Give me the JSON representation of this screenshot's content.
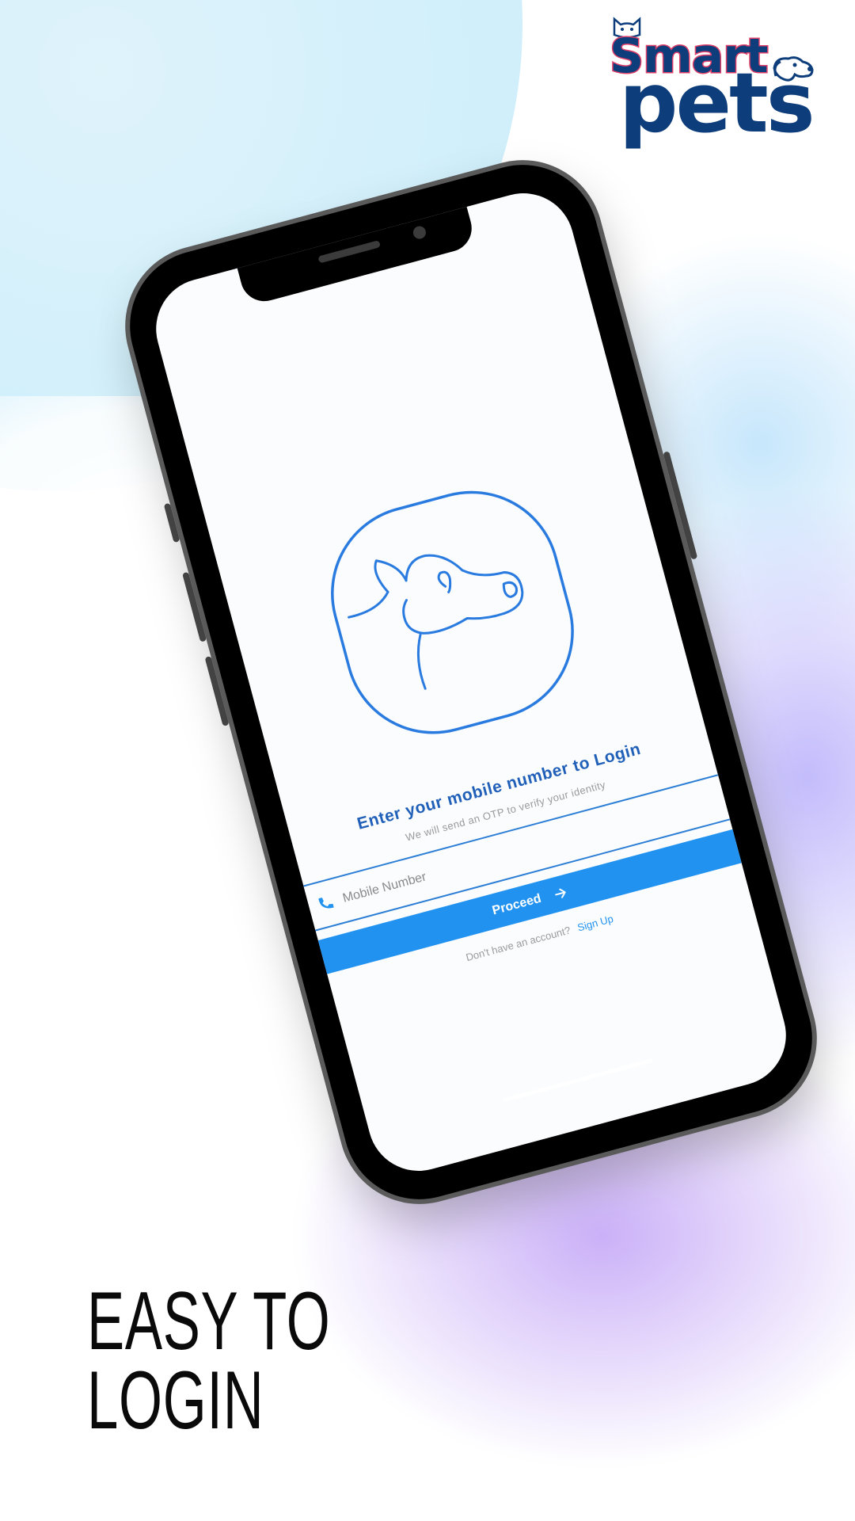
{
  "brand": {
    "name_top": "Smart",
    "name_bottom": "pets",
    "primary_color": "#0d3d7a",
    "accent_color": "#e0406a"
  },
  "login_screen": {
    "title": "Enter your mobile number to Login",
    "subtitle": "We will send an OTP to verify your identity",
    "mobile_field": {
      "placeholder": "Mobile Number",
      "value": "",
      "icon": "phone-icon"
    },
    "proceed_button": {
      "label": "Proceed",
      "icon": "arrow-right-icon"
    },
    "signup_prompt": "Don't have an account?",
    "signup_link": "Sign Up",
    "illustration": "cow-head-icon",
    "accent_color": "#2192f0"
  },
  "headline": {
    "line1": "EASY TO",
    "line2": "LOGIN"
  }
}
